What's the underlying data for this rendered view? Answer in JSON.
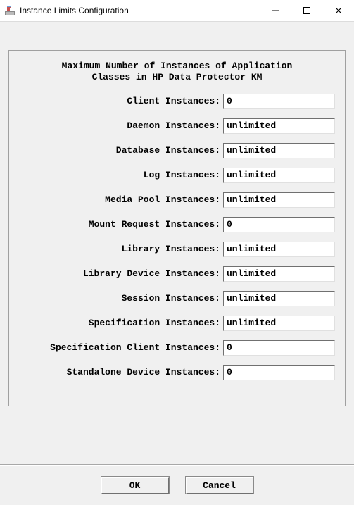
{
  "window": {
    "title": "Instance Limits Configuration"
  },
  "panel": {
    "heading_line1": "Maximum Number of Instances of Application",
    "heading_line2": "Classes in HP Data Protector KM"
  },
  "fields": [
    {
      "label": "Client Instances:",
      "value": "0"
    },
    {
      "label": "Daemon Instances:",
      "value": "unlimited"
    },
    {
      "label": "Database Instances:",
      "value": "unlimited"
    },
    {
      "label": "Log Instances:",
      "value": "unlimited"
    },
    {
      "label": "Media Pool Instances:",
      "value": "unlimited"
    },
    {
      "label": "Mount Request Instances:",
      "value": "0"
    },
    {
      "label": "Library Instances:",
      "value": "unlimited"
    },
    {
      "label": "Library Device Instances:",
      "value": "unlimited"
    },
    {
      "label": "Session Instances:",
      "value": "unlimited"
    },
    {
      "label": "Specification Instances:",
      "value": "unlimited"
    },
    {
      "label": "Specification Client Instances:",
      "value": "0"
    },
    {
      "label": "Standalone Device Instances:",
      "value": "0"
    }
  ],
  "buttons": {
    "ok": "OK",
    "cancel": "Cancel"
  }
}
